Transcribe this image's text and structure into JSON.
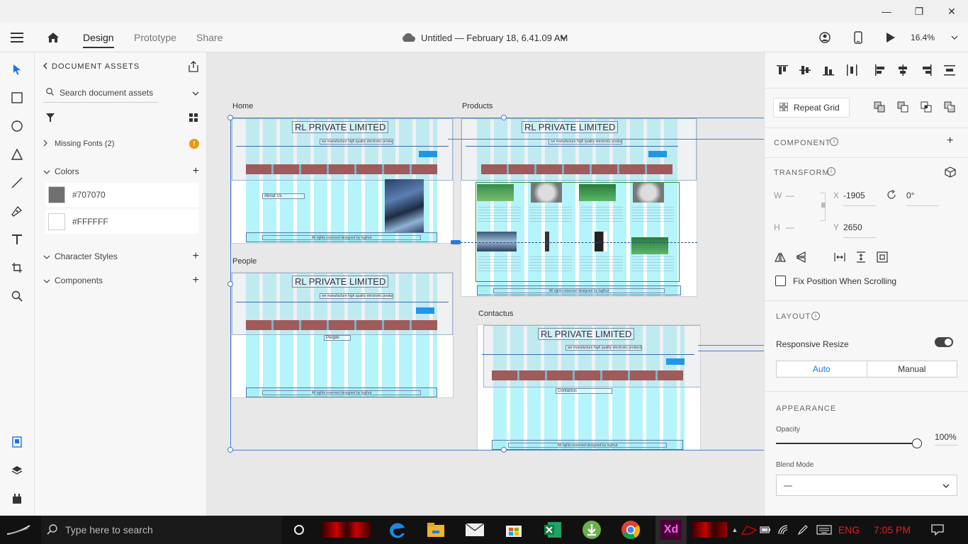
{
  "window": {
    "minimize_glyph": "—",
    "restore_glyph": "❐",
    "close_glyph": "✕"
  },
  "appbar": {
    "tabs": [
      "Design",
      "Prototype",
      "Share"
    ],
    "doc_title": "Untitled — February 18, 6.41.09 AM",
    "zoom": "16.4%"
  },
  "assets": {
    "header": "DOCUMENT ASSETS",
    "search_placeholder": "Search document assets",
    "missing_fonts": "Missing Fonts (2)",
    "colors_label": "Colors",
    "colors": [
      {
        "hex": "#707070",
        "label": "#707070"
      },
      {
        "hex": "#FFFFFF",
        "label": "#FFFFFF"
      }
    ],
    "character_styles": "Character Styles",
    "components": "Components"
  },
  "canvas": {
    "artboards": {
      "home": "Home",
      "products": "Products",
      "people": "People",
      "contactus": "Contactus"
    },
    "brand": "RL PRIVATE LIMITED",
    "tagline": "we manufacture high quality electronic products",
    "footer_text": "All rights reserved designed by logihut",
    "about_us": "About Us",
    "people_page": "People",
    "contactus_page": "Contactus"
  },
  "props": {
    "repeat_grid": "Repeat Grid",
    "component": "COMPONENT",
    "transform": "TRANSFORM",
    "w_label": "W",
    "w_value": "—",
    "h_label": "H",
    "h_value": "—",
    "x_label": "X",
    "x_value": "-1905",
    "y_label": "Y",
    "y_value": "2650",
    "rotation": "0°",
    "fix_position": "Fix Position When Scrolling",
    "layout": "LAYOUT",
    "responsive_resize": "Responsive Resize",
    "auto": "Auto",
    "manual": "Manual",
    "appearance": "APPEARANCE",
    "opacity_label": "Opacity",
    "opacity_value": "100%",
    "opacity_level": 1.0,
    "blend_mode_label": "Blend Mode",
    "blend_mode_value": "—"
  },
  "taskbar": {
    "search_placeholder": "Type here to search",
    "language": "ENG",
    "time": "7:05 PM"
  }
}
